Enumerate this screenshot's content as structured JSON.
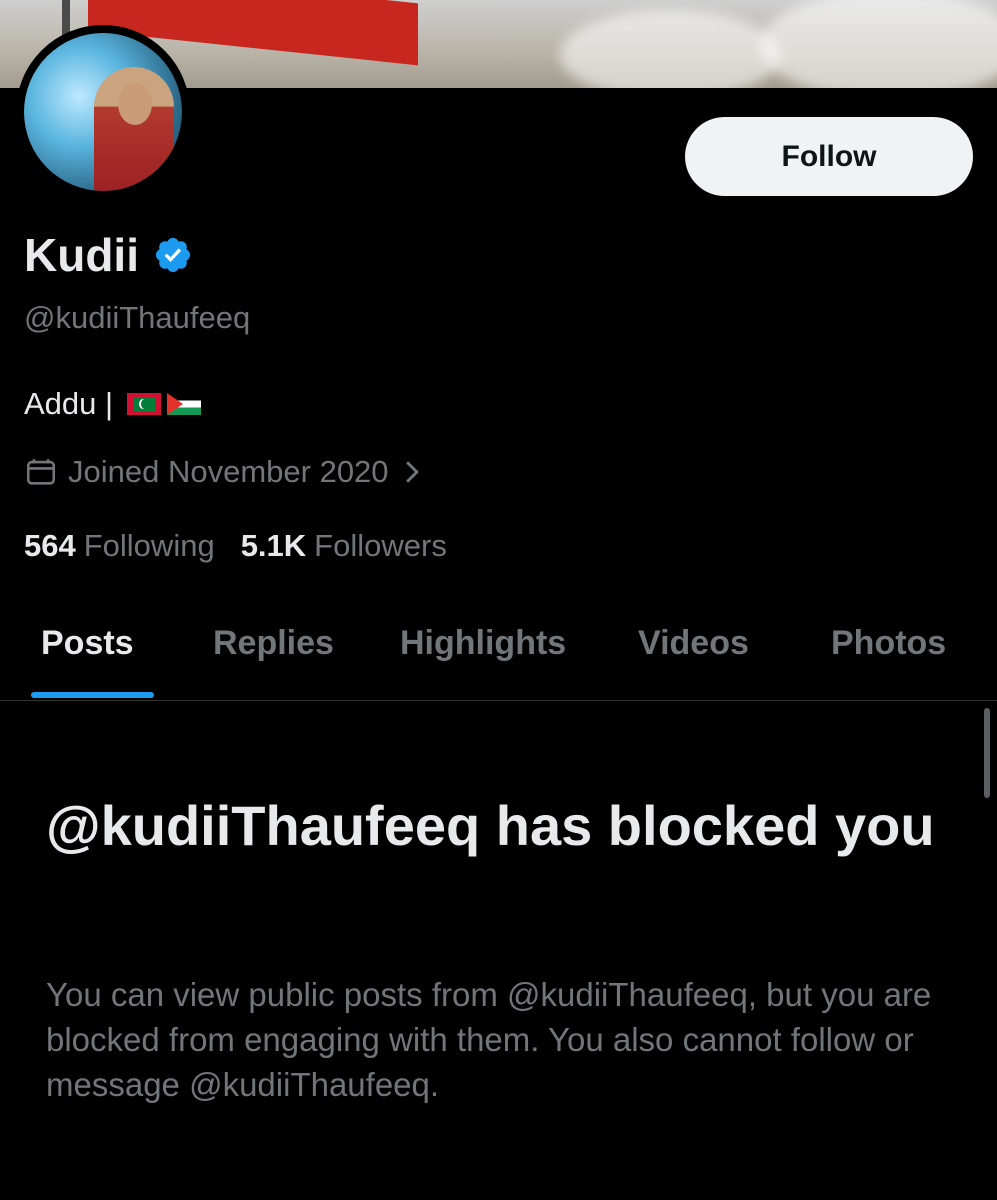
{
  "profile": {
    "name": "Kudii",
    "handle": "@kudiiThaufeeq",
    "bio": "Addu |",
    "joined": "Joined November 2020",
    "following_count": "564",
    "following_label": "Following",
    "followers_count": "5.1K",
    "followers_label": "Followers"
  },
  "actions": {
    "follow_label": "Follow"
  },
  "tabs": [
    {
      "label": "Posts",
      "active": true
    },
    {
      "label": "Replies",
      "active": false
    },
    {
      "label": "Highlights",
      "active": false
    },
    {
      "label": "Videos",
      "active": false
    },
    {
      "label": "Photos",
      "active": false
    }
  ],
  "blocked": {
    "title": "@kudiiThaufeeq has blocked you",
    "description": "You can view public posts from @kudiiThaufeeq, but you are blocked from engaging with them. You also cannot follow or message @kudiiThaufeeq."
  },
  "icons": {
    "verified": "verified-badge-icon",
    "calendar": "calendar-icon",
    "chevron": "chevron-right-icon"
  },
  "colors": {
    "accent": "#1d9bf0",
    "background": "#000000",
    "primary_text": "#e7e9ea",
    "secondary_text": "#71767b"
  }
}
